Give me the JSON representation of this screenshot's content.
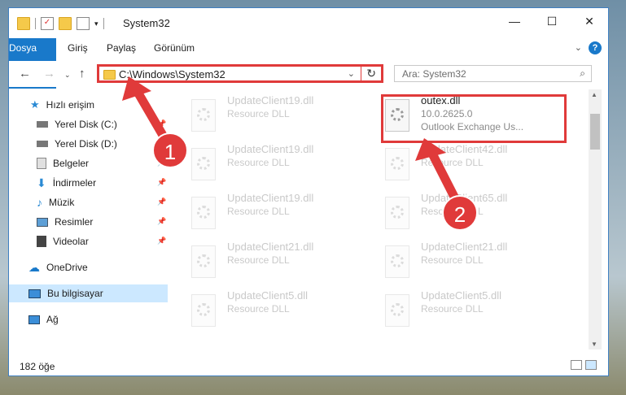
{
  "window": {
    "title": "System32",
    "controls": {
      "minimize": "—",
      "maximize": "☐",
      "close": "✕"
    }
  },
  "menu": {
    "file": "Dosya",
    "home": "Giriş",
    "share": "Paylaş",
    "view": "Görünüm",
    "help": "?"
  },
  "address": {
    "path": "C:\\Windows\\System32"
  },
  "search": {
    "placeholder": "Ara: System32"
  },
  "sidebar": {
    "items": [
      {
        "label": "Hızlı erişim",
        "icon": "star-icon"
      },
      {
        "label": "Yerel Disk (C:)",
        "icon": "drive-icon"
      },
      {
        "label": "Yerel Disk (D:)",
        "icon": "drive-icon"
      },
      {
        "label": "Belgeler",
        "icon": "documents-icon"
      },
      {
        "label": "İndirmeler",
        "icon": "download-icon"
      },
      {
        "label": "Müzik",
        "icon": "music-icon"
      },
      {
        "label": "Resimler",
        "icon": "pictures-icon"
      },
      {
        "label": "Videolar",
        "icon": "video-icon"
      },
      {
        "label": "OneDrive",
        "icon": "cloud-icon"
      },
      {
        "label": "Bu bilgisayar",
        "icon": "computer-icon"
      },
      {
        "label": "Ağ",
        "icon": "network-icon"
      }
    ]
  },
  "files": [
    {
      "name": "UpdateClient19.dll",
      "sub": "Resource DLL"
    },
    {
      "name": "outex.dll",
      "version": "10.0.2625.0",
      "desc": "Outlook Exchange Us..."
    },
    {
      "name": "UpdateClient19.dll",
      "sub": "Resource DLL"
    },
    {
      "name": "UpdateClient42.dll",
      "sub": "Resource DLL"
    },
    {
      "name": "UpdateClient19.dll",
      "sub": "Resource DLL"
    },
    {
      "name": "UpdateClient65.dll",
      "sub": "Resource DLL"
    },
    {
      "name": "UpdateClient21.dll",
      "sub": "Resource DLL"
    },
    {
      "name": "UpdateClient21.dll",
      "sub": "Resource DLL"
    },
    {
      "name": "UpdateClient5.dll",
      "sub": "Resource DLL"
    },
    {
      "name": "UpdateClient5.dll",
      "sub": "Resource DLL"
    }
  ],
  "status": {
    "count": "182 öğe"
  },
  "callouts": {
    "one": "1",
    "two": "2"
  },
  "colors": {
    "accent": "#1979ca",
    "highlight": "#e03a3a"
  }
}
